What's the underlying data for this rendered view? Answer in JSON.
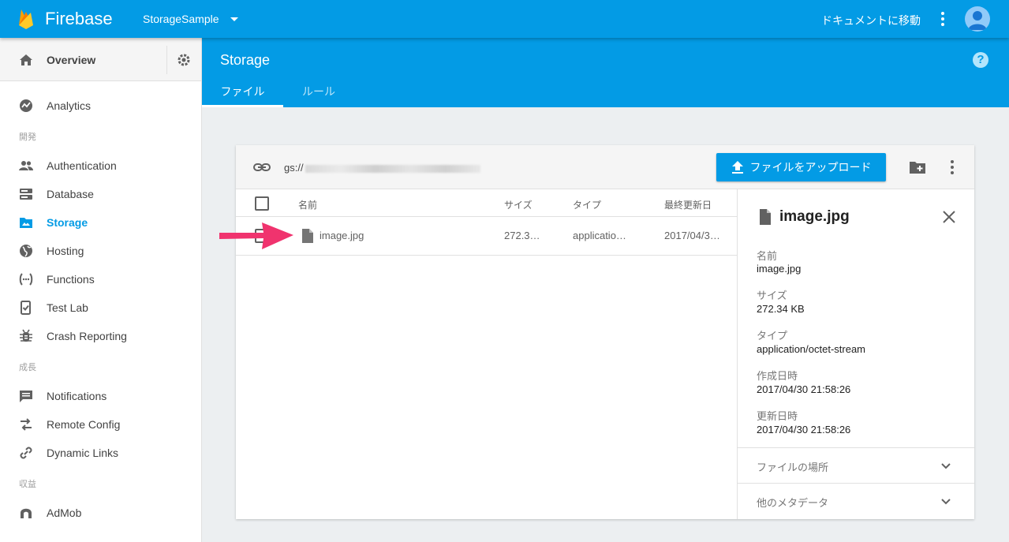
{
  "topbar": {
    "brand": "Firebase",
    "project": "StorageSample",
    "docs_link": "ドキュメントに移動"
  },
  "sidebar": {
    "overview": "Overview",
    "items": [
      {
        "label": "Analytics",
        "icon": "analytics-icon"
      },
      {
        "label": "Authentication",
        "icon": "people-icon"
      },
      {
        "label": "Database",
        "icon": "database-icon"
      },
      {
        "label": "Storage",
        "icon": "folder-image-icon",
        "active": true
      },
      {
        "label": "Hosting",
        "icon": "globe-icon"
      },
      {
        "label": "Functions",
        "icon": "functions-icon"
      },
      {
        "label": "Test Lab",
        "icon": "test-lab-icon"
      },
      {
        "label": "Crash Reporting",
        "icon": "bug-icon"
      },
      {
        "label": "Notifications",
        "icon": "message-icon"
      },
      {
        "label": "Remote Config",
        "icon": "remote-config-icon"
      },
      {
        "label": "Dynamic Links",
        "icon": "link-icon"
      },
      {
        "label": "AdMob",
        "icon": "admob-icon"
      }
    ],
    "sections": {
      "develop": "開発",
      "grow": "成長",
      "earn": "収益"
    }
  },
  "storage": {
    "title": "Storage",
    "tabs": [
      "ファイル",
      "ルール"
    ],
    "active_tab": "ファイル"
  },
  "card": {
    "bucket_prefix": "gs://",
    "upload_label": "ファイルをアップロード",
    "columns": [
      "名前",
      "サイズ",
      "タイプ",
      "最終更新日"
    ],
    "rows": [
      {
        "name": "image.jpg",
        "size": "272.3…",
        "type": "applicatio…",
        "updated": "2017/04/3…"
      }
    ]
  },
  "detail": {
    "title": "image.jpg",
    "fields": [
      {
        "label": "名前",
        "value": "image.jpg"
      },
      {
        "label": "サイズ",
        "value": "272.34 KB"
      },
      {
        "label": "タイプ",
        "value": "application/octet-stream"
      },
      {
        "label": "作成日時",
        "value": "2017/04/30 21:58:26"
      },
      {
        "label": "更新日時",
        "value": "2017/04/30 21:58:26"
      }
    ],
    "accordions": [
      "ファイルの場所",
      "他のメタデータ"
    ]
  },
  "colors": {
    "primary": "#039be5",
    "annotation_arrow": "#f0336e"
  }
}
